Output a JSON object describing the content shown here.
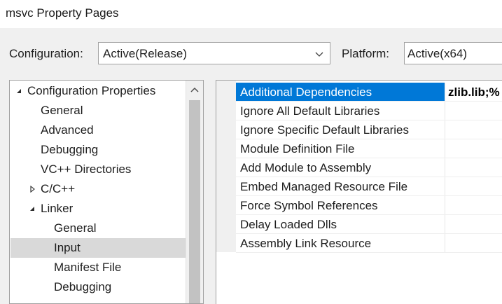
{
  "window": {
    "title": "msvc Property Pages"
  },
  "toolbar": {
    "configuration_label": "Configuration:",
    "configuration_value": "Active(Release)",
    "platform_label": "Platform:",
    "platform_value": "Active(x64)"
  },
  "tree": {
    "items": [
      {
        "label": "Configuration Properties",
        "level": 0,
        "expander": "expanded",
        "selected": false
      },
      {
        "label": "General",
        "level": 1,
        "expander": "none",
        "selected": false
      },
      {
        "label": "Advanced",
        "level": 1,
        "expander": "none",
        "selected": false
      },
      {
        "label": "Debugging",
        "level": 1,
        "expander": "none",
        "selected": false
      },
      {
        "label": "VC++ Directories",
        "level": 1,
        "expander": "none",
        "selected": false
      },
      {
        "label": "C/C++",
        "level": 1,
        "expander": "collapsed",
        "selected": false
      },
      {
        "label": "Linker",
        "level": 1,
        "expander": "expanded",
        "selected": false
      },
      {
        "label": "General",
        "level": 2,
        "expander": "none",
        "selected": false
      },
      {
        "label": "Input",
        "level": 2,
        "expander": "none",
        "selected": true
      },
      {
        "label": "Manifest File",
        "level": 2,
        "expander": "none",
        "selected": false
      },
      {
        "label": "Debugging",
        "level": 2,
        "expander": "none",
        "selected": false
      }
    ]
  },
  "properties": [
    {
      "name": "Additional Dependencies",
      "value": "zlib.lib;%",
      "selected": true
    },
    {
      "name": "Ignore All Default Libraries",
      "value": "",
      "selected": false
    },
    {
      "name": "Ignore Specific Default Libraries",
      "value": "",
      "selected": false
    },
    {
      "name": "Module Definition File",
      "value": "",
      "selected": false
    },
    {
      "name": "Add Module to Assembly",
      "value": "",
      "selected": false
    },
    {
      "name": "Embed Managed Resource File",
      "value": "",
      "selected": false
    },
    {
      "name": "Force Symbol References",
      "value": "",
      "selected": false
    },
    {
      "name": "Delay Loaded Dlls",
      "value": "",
      "selected": false
    },
    {
      "name": "Assembly Link Resource",
      "value": "",
      "selected": false
    }
  ],
  "colors": {
    "selection_blue": "#0078d7",
    "tree_selection": "#d9d9d9"
  },
  "icons": {
    "dropdown": "chevron-down-icon",
    "tree_expanded": "triangle-expanded-icon",
    "tree_collapsed": "triangle-collapsed-icon",
    "scroll_up": "chevron-up-icon"
  }
}
